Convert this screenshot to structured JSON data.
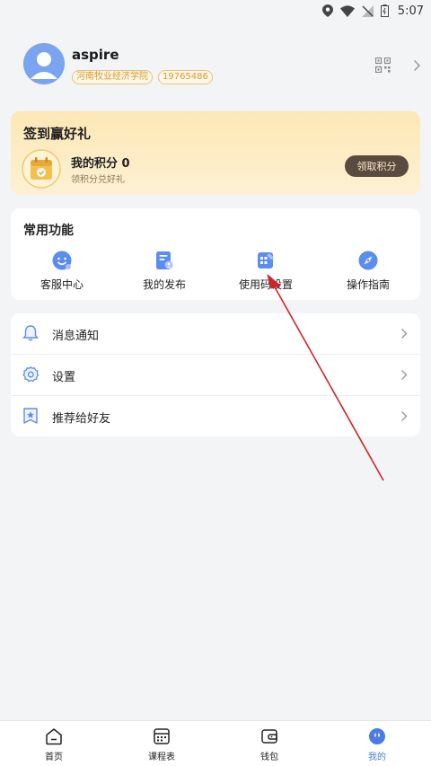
{
  "status_bar": {
    "time": "5:07"
  },
  "profile": {
    "username": "aspire",
    "school_tag": "河南牧业经济学院",
    "id_tag": "19765486"
  },
  "signin": {
    "title": "签到赢好礼",
    "points_label": "我的积分 0",
    "points_sub": "领积分兑好礼",
    "claim_button": "领取积分"
  },
  "functions": {
    "title": "常用功能",
    "items": [
      {
        "label": "客服中心",
        "icon": "customer-service-icon"
      },
      {
        "label": "我的发布",
        "icon": "my-posts-icon"
      },
      {
        "label": "使用码设置",
        "icon": "code-settings-icon"
      },
      {
        "label": "操作指南",
        "icon": "compass-icon"
      }
    ]
  },
  "menu": {
    "items": [
      {
        "label": "消息通知",
        "icon": "bell-icon"
      },
      {
        "label": "设置",
        "icon": "gear-icon"
      },
      {
        "label": "推荐给好友",
        "icon": "star-badge-icon"
      }
    ]
  },
  "tab_bar": {
    "tabs": [
      {
        "label": "首页",
        "icon": "home-icon"
      },
      {
        "label": "课程表",
        "icon": "schedule-icon"
      },
      {
        "label": "钱包",
        "icon": "wallet-icon"
      },
      {
        "label": "我的",
        "icon": "profile-icon",
        "active": true
      }
    ]
  },
  "colors": {
    "accent": "#4b7be5",
    "card_gold": "#fde7b5",
    "button_dark": "#5a4b40",
    "annotation_arrow": "#d0242b"
  }
}
